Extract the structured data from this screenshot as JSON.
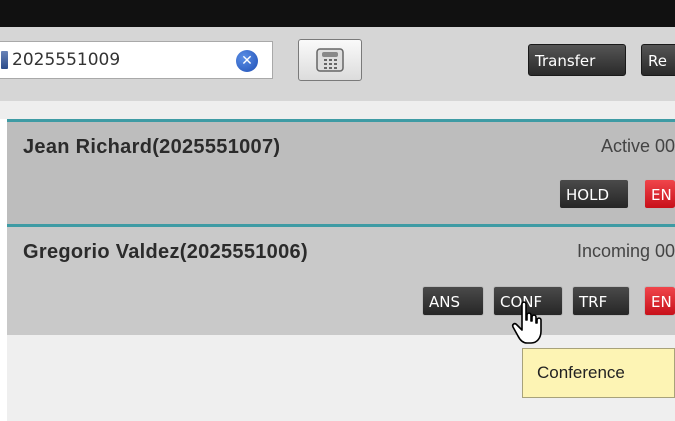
{
  "dialer": {
    "phone_value": "2025551009",
    "clear_label": "✕",
    "buttons": {
      "transfer": "Transfer",
      "re": "Re"
    }
  },
  "calls": [
    {
      "caller": "Jean Richard(2025551007)",
      "status": "Active 00",
      "buttons": {
        "hold": "HOLD",
        "end": "EN"
      }
    },
    {
      "caller": "Gregorio Valdez(2025551006)",
      "status": "Incoming 00",
      "buttons": {
        "ans": "ANS",
        "conf": "CONF",
        "trf": "TRF",
        "end": "EN"
      }
    }
  ],
  "tooltip": "Conference",
  "colors": {
    "accent_teal": "#3e9ba4",
    "end_red": "#d81c24",
    "clear_blue": "#2a5fd0"
  },
  "icons": {
    "phone_book": "phone-book-icon",
    "clear": "clear-circle-icon",
    "dial": "telephone-icon",
    "cursor": "hand-cursor-icon"
  }
}
